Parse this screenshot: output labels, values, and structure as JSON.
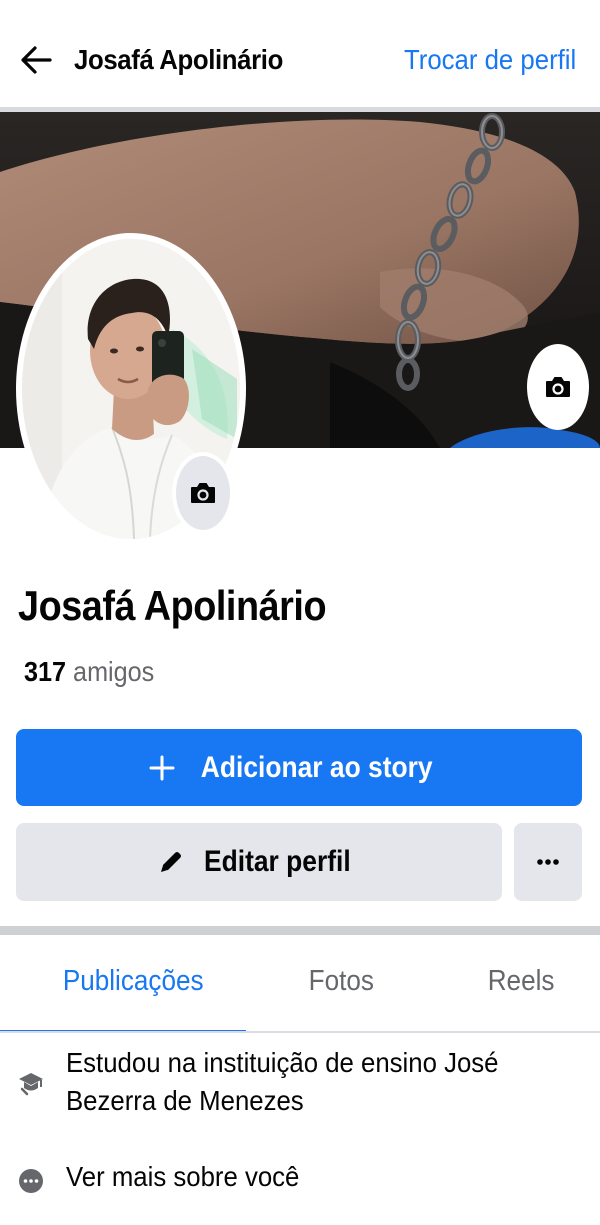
{
  "header": {
    "back_icon": "arrow-left-icon",
    "title": "Josafá Apolinário",
    "switch_profile": "Trocar de perfil"
  },
  "profile": {
    "name": "Josafá Apolinário",
    "friends_count": "317",
    "friends_label": "amigos"
  },
  "actions": {
    "add_story": "Adicionar ao story",
    "edit_profile": "Editar perfil",
    "more_icon": "more-dots-icon"
  },
  "tabs": [
    {
      "label": "Publicações",
      "active": true
    },
    {
      "label": "Fotos",
      "active": false
    },
    {
      "label": "Reels",
      "active": false
    }
  ],
  "intro": {
    "education": "Estudou na instituição de ensino José Bezerra de Menezes",
    "see_more": "Ver mais sobre você"
  },
  "colors": {
    "accent": "#1877f2",
    "button_secondary": "#e4e6eb",
    "text_secondary": "#65676b"
  }
}
